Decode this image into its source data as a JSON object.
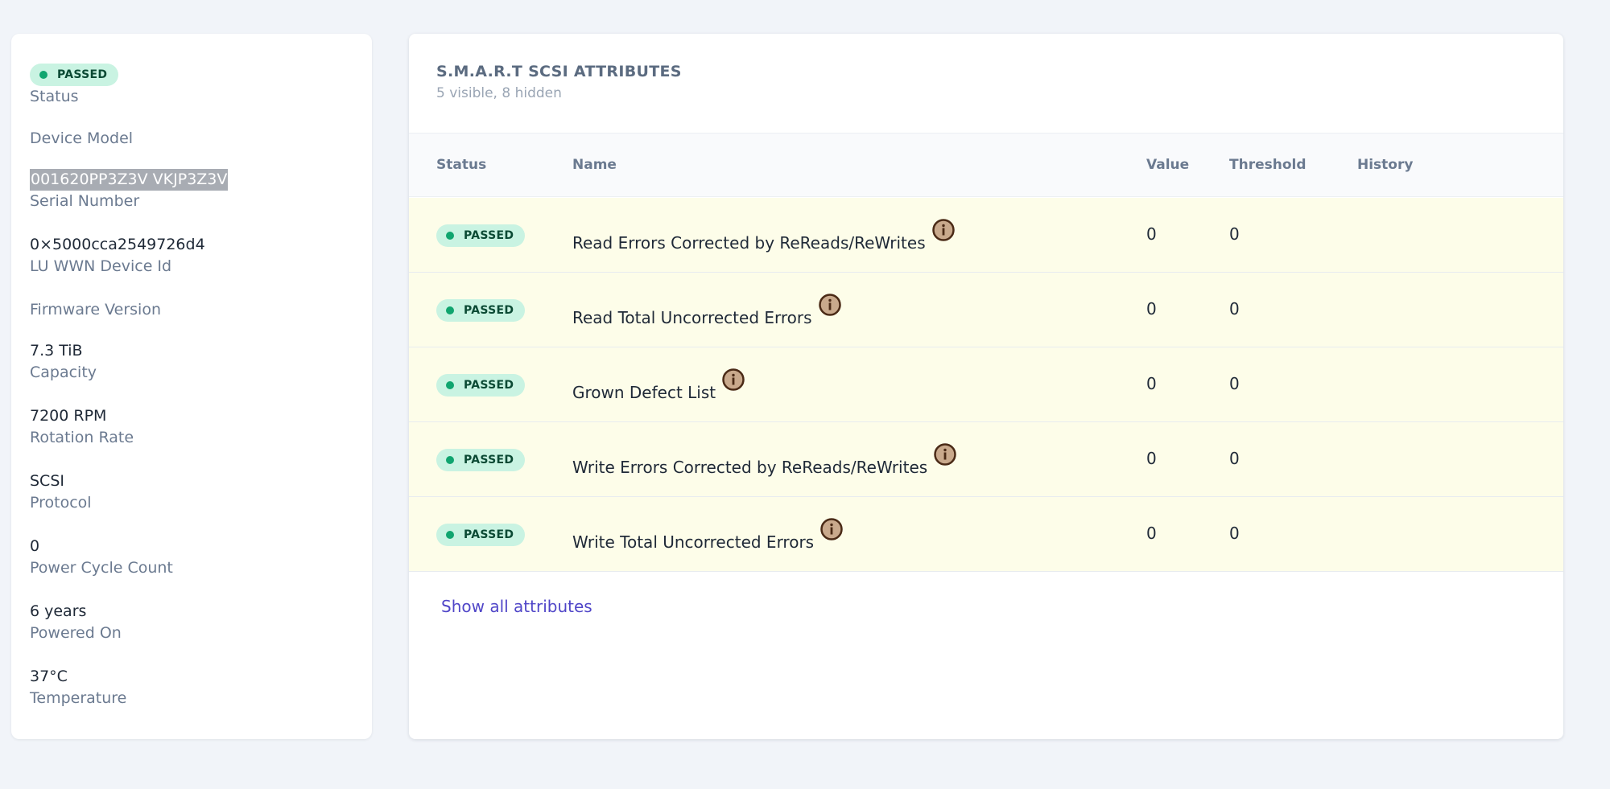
{
  "device": {
    "status_badge": "PASSED",
    "status_label": "Status",
    "device_model_label": "Device Model",
    "serial_number_value": "001620PP3Z3V VKJP3Z3V",
    "serial_number_label": "Serial Number",
    "wwn_value": "0×5000cca2549726d4",
    "wwn_label": "LU WWN Device Id",
    "firmware_label": "Firmware Version",
    "capacity_value": "7.3 TiB",
    "capacity_label": "Capacity",
    "rotation_value": "7200 RPM",
    "rotation_label": "Rotation Rate",
    "protocol_value": "SCSI",
    "protocol_label": "Protocol",
    "power_cycle_value": "0",
    "power_cycle_label": "Power Cycle Count",
    "powered_on_value": "6 years",
    "powered_on_label": "Powered On",
    "temperature_value": "37°C",
    "temperature_label": "Temperature"
  },
  "attributes": {
    "title": "S.M.A.R.T SCSI ATTRIBUTES",
    "subtitle": "5 visible, 8 hidden",
    "columns": {
      "status": "Status",
      "name": "Name",
      "value": "Value",
      "threshold": "Threshold",
      "history": "History"
    },
    "rows": [
      {
        "status": "PASSED",
        "name": "Read Errors Corrected by ReReads/ReWrites",
        "value": "0",
        "threshold": "0"
      },
      {
        "status": "PASSED",
        "name": "Read Total Uncorrected Errors",
        "value": "0",
        "threshold": "0"
      },
      {
        "status": "PASSED",
        "name": "Grown Defect List",
        "value": "0",
        "threshold": "0"
      },
      {
        "status": "PASSED",
        "name": "Write Errors Corrected by ReReads/ReWrites",
        "value": "0",
        "threshold": "0"
      },
      {
        "status": "PASSED",
        "name": "Write Total Uncorrected Errors",
        "value": "0",
        "threshold": "0"
      }
    ],
    "show_all_link": "Show all attributes"
  },
  "icons": {
    "status_dot": "status-dot-icon",
    "info": "info-icon"
  },
  "colors": {
    "passed_badge_bg": "#c9f3e2",
    "passed_dot": "#10a56f",
    "row_highlight": "#fdfde9",
    "link": "#5046c8",
    "info_icon_fill": "#c9a98c",
    "info_icon_stroke": "#4a2a16"
  }
}
